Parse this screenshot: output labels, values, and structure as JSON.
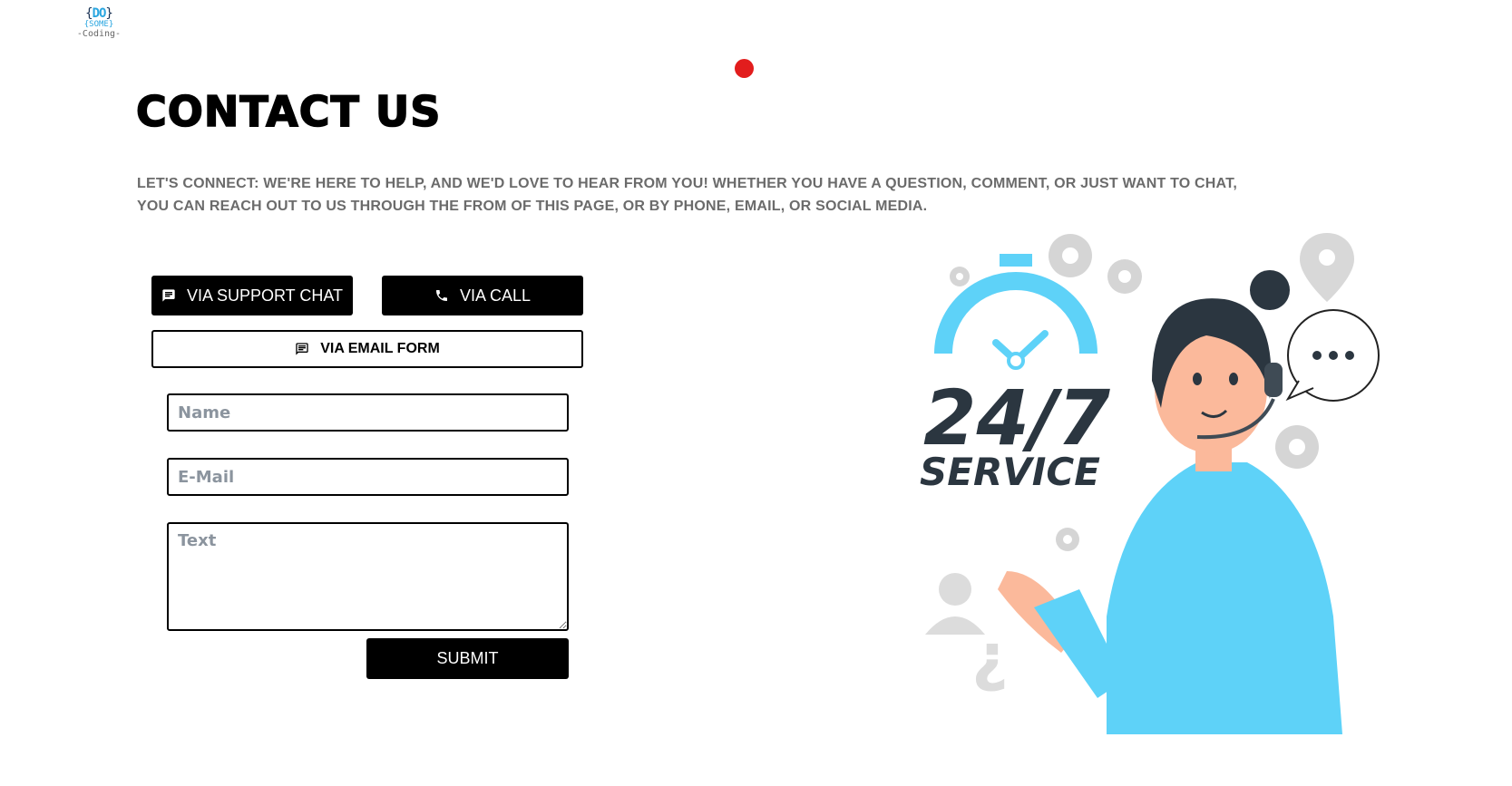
{
  "logo": {
    "line1_left": "{",
    "line1_mid": "DO",
    "line1_right": "}",
    "line2": "{SOME}",
    "line3": "-Coding-"
  },
  "page": {
    "title": "CONTACT US",
    "intro": "LET'S CONNECT: WE'RE HERE TO HELP, AND WE'D LOVE TO HEAR FROM YOU! WHETHER YOU HAVE A QUESTION, COMMENT, OR JUST WANT TO CHAT, YOU CAN REACH OUT TO US THROUGH THE FROM OF THIS PAGE, OR BY PHONE, EMAIL, OR SOCIAL MEDIA."
  },
  "contact_options": {
    "chat_label": "VIA SUPPORT CHAT",
    "call_label": "VIA CALL",
    "email_label": "VIA EMAIL FORM"
  },
  "form": {
    "name_placeholder": "Name",
    "email_placeholder": "E-Mail",
    "text_placeholder": "Text",
    "submit_label": "SUBMIT"
  },
  "illustration": {
    "headline": "24/7",
    "subline": "SERVICE"
  },
  "colors": {
    "accent": "#5ed2f8",
    "primary": "#000000",
    "record_dot": "#e21d1d"
  },
  "icons": [
    "chat-icon",
    "phone-icon",
    "message-icon"
  ]
}
